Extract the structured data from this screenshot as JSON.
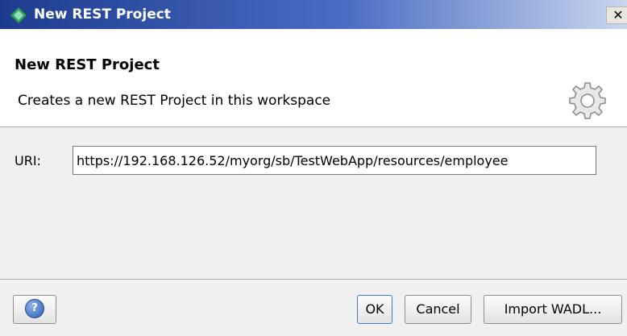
{
  "window": {
    "title": "New REST Project",
    "close_glyph": "✕"
  },
  "banner": {
    "title": "New REST Project",
    "description": "Creates a new REST Project in this workspace",
    "icon": "gear-icon"
  },
  "form": {
    "uri_label": "URI:",
    "uri_value": "https://192.168.126.52/myorg/sb/TestWebApp/resources/employee"
  },
  "footer": {
    "help_glyph": "?",
    "ok_label": "OK",
    "cancel_label": "Cancel",
    "import_label": "Import WADL..."
  },
  "colors": {
    "titlebar_start": "#1d3c90",
    "titlebar_end": "#c9d6ee",
    "app_icon": "#3aa06f"
  }
}
